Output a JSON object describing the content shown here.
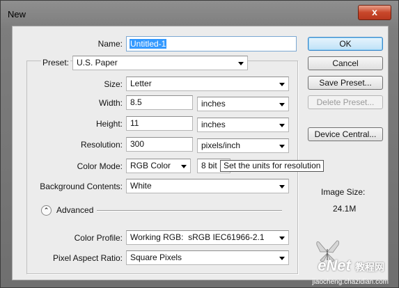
{
  "window": {
    "title": "New",
    "close_glyph": "x"
  },
  "name": {
    "label": "Name:",
    "value": "Untitled-1"
  },
  "preset": {
    "label": "Preset:",
    "value": "U.S. Paper"
  },
  "size": {
    "label": "Size:",
    "value": "Letter"
  },
  "width": {
    "label": "Width:",
    "value": "8.5",
    "unit": "inches"
  },
  "height": {
    "label": "Height:",
    "value": "11",
    "unit": "inches"
  },
  "resolution": {
    "label": "Resolution:",
    "value": "300",
    "unit": "pixels/inch"
  },
  "color_mode": {
    "label": "Color Mode:",
    "value": "RGB Color",
    "depth": "8 bit"
  },
  "tooltip": "Set the units for resolution",
  "background": {
    "label": "Background Contents:",
    "value": "White"
  },
  "advanced": {
    "label": "Advanced"
  },
  "color_profile": {
    "label": "Color Profile:",
    "value": "Working RGB:  sRGB IEC61966-2.1"
  },
  "pixel_aspect": {
    "label": "Pixel Aspect Ratio:",
    "value": "Square Pixels"
  },
  "buttons": {
    "ok": "OK",
    "cancel": "Cancel",
    "save_preset": "Save Preset...",
    "delete_preset": "Delete Preset...",
    "device_central": "Device Central..."
  },
  "image_size": {
    "label": "Image Size:",
    "value": "24.1M"
  },
  "watermark": {
    "brand": "eNet",
    "cn": "教程网",
    "url": "jiaocheng.chazidian.com"
  }
}
